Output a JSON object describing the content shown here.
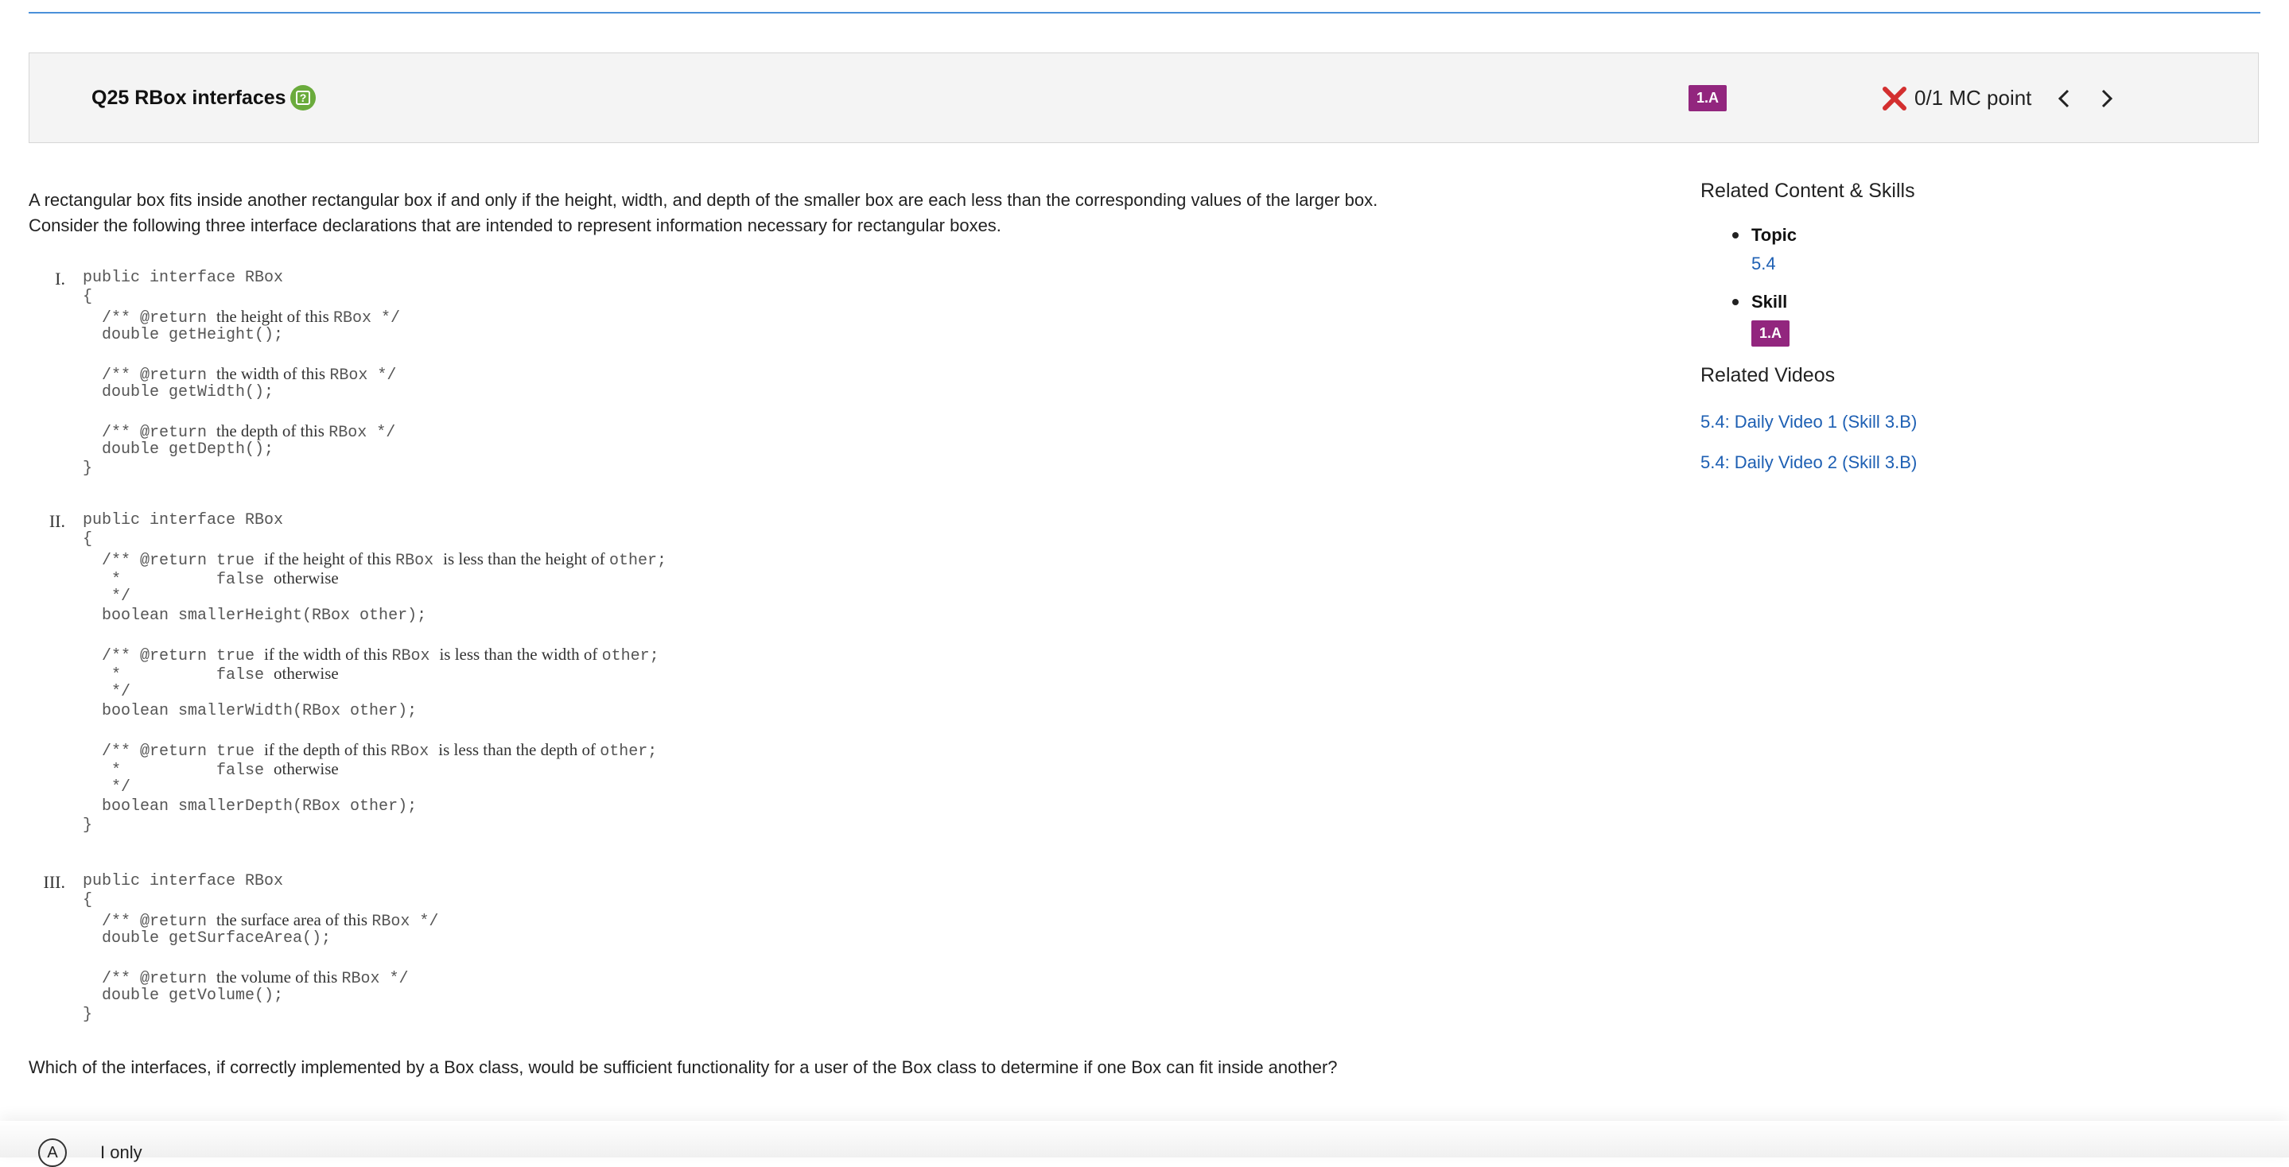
{
  "header": {
    "title": "Q25 RBox interfaces",
    "skill_badge": "1.A",
    "points": "0/1 MC point"
  },
  "prompt": {
    "line1": "A rectangular box fits inside another rectangular box if and only if the height, width, and depth of the smaller box are each less than the corresponding values of the larger box.",
    "line2": "Consider the following three interface declarations that are intended to represent information necessary for rectangular boxes."
  },
  "interfaces": {
    "i": {
      "numeral": "I.",
      "decl": "public interface RBox",
      "open": "{",
      "close": "}",
      "m1_pre": "  /** @return ",
      "m1_text": "the height of this ",
      "m1_code": "RBox */",
      "m1_sig": "  double getHeight();",
      "m2_pre": "  /** @return ",
      "m2_text": "the width of this ",
      "m2_code": "RBox */",
      "m2_sig": "  double getWidth();",
      "m3_pre": "  /** @return ",
      "m3_text": "the depth of this ",
      "m3_code": "RBox */",
      "m3_sig": "  double getDepth();"
    },
    "ii": {
      "numeral": "II.",
      "decl": "public interface RBox",
      "open": "{",
      "close": "}",
      "ret_true": "  /** @return true ",
      "star_false": "   *          false ",
      "otherwise": "otherwise",
      "star_end": "   */",
      "m1_a": "if the height of this ",
      "m1_b": "RBox ",
      "m1_c": "is less than the height of ",
      "m1_d": "other;",
      "m1_sig": "  boolean smallerHeight(RBox other);",
      "m2_a": "if the width of this ",
      "m2_b": "RBox ",
      "m2_c": "is less than the width of ",
      "m2_d": "other;",
      "m2_sig": "  boolean smallerWidth(RBox other);",
      "m3_a": "if the depth of this ",
      "m3_b": "RBox ",
      "m3_c": "is less than the depth of ",
      "m3_d": "other;",
      "m3_sig": "  boolean smallerDepth(RBox other);"
    },
    "iii": {
      "numeral": "III.",
      "decl": "public interface RBox",
      "open": "{",
      "close": "}",
      "m1_pre": "  /** @return ",
      "m1_text": "the surface area of this ",
      "m1_code": "RBox */",
      "m1_sig": "  double getSurfaceArea();",
      "m2_pre": "  /** @return ",
      "m2_text": "the volume of this ",
      "m2_code": "RBox */",
      "m2_sig": "  double getVolume();"
    }
  },
  "question": "Which of the interfaces, if correctly implemented by a Box class, would be sufficient functionality for a user of the Box class to determine if one Box can fit inside another?",
  "answer_option": {
    "letter": "A",
    "text": "I only"
  },
  "sidebar": {
    "related_heading": "Related Content & Skills",
    "topic_label": "Topic",
    "topic_value": "5.4",
    "skill_label": "Skill",
    "skill_value": "1.A",
    "videos_heading": "Related Videos",
    "videos": [
      "5.4: Daily Video 1 (Skill 3.B)",
      "5.4: Daily Video 2 (Skill 3.B)"
    ]
  },
  "colors": {
    "skill_badge": "#92267e",
    "incorrect": "#d32f2f",
    "link": "#1d5fb3",
    "accent_line": "#4a90d9",
    "help_icon": "#6aab3c"
  }
}
